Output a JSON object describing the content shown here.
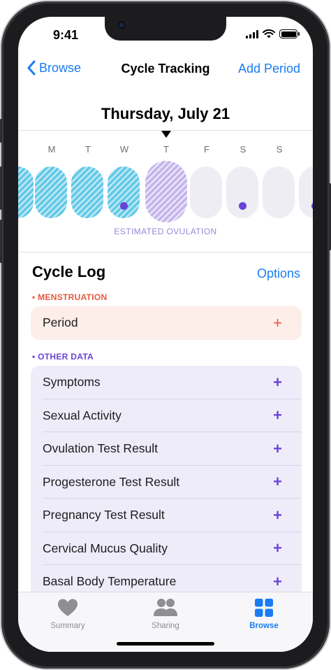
{
  "status_bar": {
    "time": "9:41"
  },
  "nav": {
    "back_label": "Browse",
    "title": "Cycle Tracking",
    "action_label": "Add Period"
  },
  "calendar": {
    "date_title": "Thursday, July 21",
    "weekdays": [
      "M",
      "T",
      "W",
      "T",
      "F",
      "S",
      "S"
    ],
    "ovulation_label": "ESTIMATED OVULATION"
  },
  "cycle_log": {
    "title": "Cycle Log",
    "options_label": "Options",
    "menstruation": {
      "section_label": "MENSTRUATION",
      "items": [
        {
          "label": "Period",
          "action": "+"
        }
      ]
    },
    "other_data": {
      "section_label": "OTHER DATA",
      "items": [
        {
          "label": "Symptoms",
          "action": "+"
        },
        {
          "label": "Sexual Activity",
          "action": "+"
        },
        {
          "label": "Ovulation Test Result",
          "action": "+"
        },
        {
          "label": "Progesterone Test Result",
          "action": "+"
        },
        {
          "label": "Pregnancy Test Result",
          "action": "+"
        },
        {
          "label": "Cervical Mucus Quality",
          "action": "+"
        },
        {
          "label": "Basal Body Temperature",
          "action": "+"
        }
      ]
    }
  },
  "tabbar": {
    "tabs": [
      {
        "label": "Summary",
        "icon": "heart-icon",
        "active": false
      },
      {
        "label": "Sharing",
        "icon": "people-icon",
        "active": false
      },
      {
        "label": "Browse",
        "icon": "grid-icon",
        "active": true
      }
    ]
  },
  "colors": {
    "accent": "#1a7cf0",
    "menstruation": "#e7583f",
    "other_data": "#6b43d6",
    "period_fill": "#5ec8e6",
    "ovulation_fill": "#c2b2ea"
  }
}
